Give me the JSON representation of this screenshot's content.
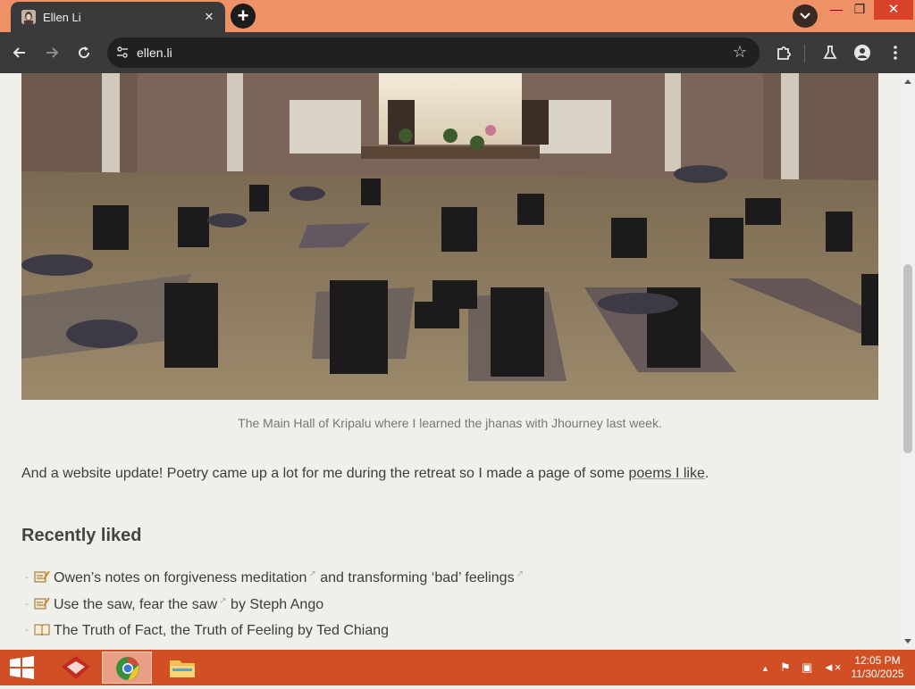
{
  "browser": {
    "tab_title": "Ellen Li",
    "tab_close": "✕",
    "new_tab": "+",
    "url": "ellen.li",
    "win_minimize": "—",
    "win_restore": "❐",
    "win_close": "✕"
  },
  "page": {
    "caption": "The Main Hall of Kripalu where I learned the jhanas with Jhourney last week.",
    "update_text": "And a website update! Poetry came up a lot for me during the retreat so I made a page of some ",
    "update_link": "poems I like",
    "update_end": ".",
    "section_title": "Recently liked",
    "liked": [
      {
        "icon": "memo-icon",
        "link1": "Owen’s notes on forgiveness meditation",
        "mid": " and transforming ",
        "link2": "‘bad’ feelings",
        "tail": ""
      },
      {
        "icon": "memo-icon",
        "link1": "Use the saw, fear the saw",
        "tail": " by Steph Ango"
      },
      {
        "icon": "book-icon",
        "link1": "The Truth of Fact, the Truth of Feeling",
        "tail": " by Ted Chiang"
      }
    ]
  },
  "taskbar": {
    "time": "12:05 PM",
    "date": "11/30/2025"
  }
}
